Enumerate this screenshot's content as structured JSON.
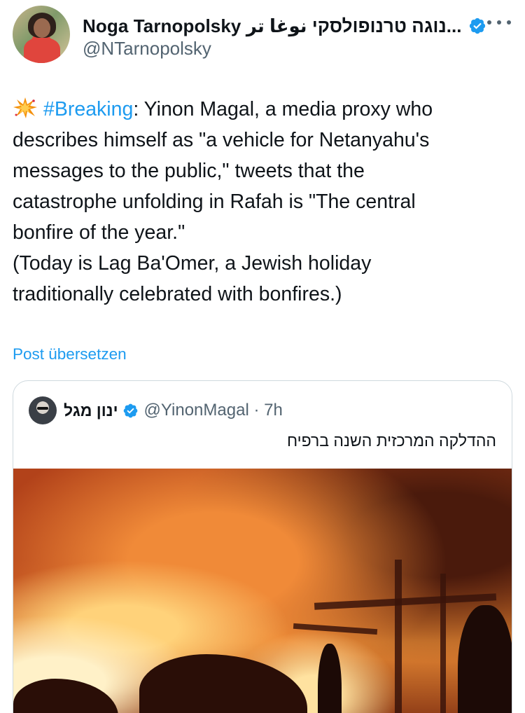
{
  "author": {
    "display_name": "Noga Tarnopolsky נוגה טרנופולסקי نوغا تر...",
    "handle": "@NTarnopolsky",
    "verified": true,
    "avatar": "avatar-noga"
  },
  "tweet": {
    "emoji": "collision-emoji",
    "hashtag": "#Breaking",
    "lines": [
      ": Yinon Magal, a media proxy who",
      "describes himself as \"a vehicle for Netanyahu's",
      "messages to the public,\" tweets that the",
      "catastrophe unfolding in Rafah is \"The central",
      "bonfire of the year.\"",
      "(Today is Lag Ba'Omer, a Jewish holiday",
      "traditionally celebrated with bonfires.)"
    ]
  },
  "translate_label": "Post übersetzen",
  "quoted": {
    "display_name": "ינון מגל",
    "handle_time": "@YinonMagal · 7h",
    "text": "ההדלקה המרכזית השנה ברפיח",
    "verified": true,
    "media": "fire-image"
  },
  "colors": {
    "accent": "#1d9bf0",
    "text": "#0f1419",
    "secondary": "#536471",
    "border": "#cfd9de"
  }
}
